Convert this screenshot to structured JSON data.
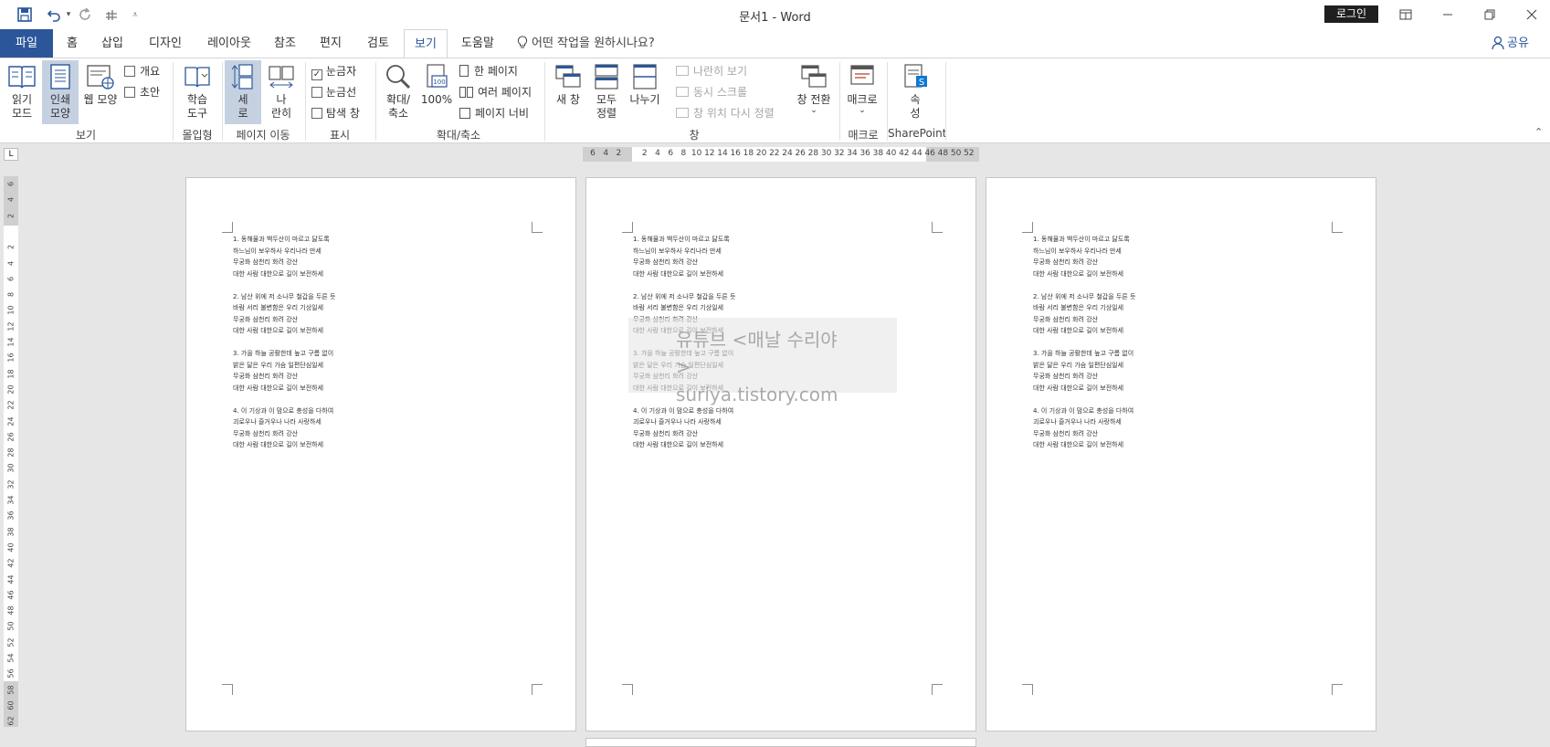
{
  "titlebar": {
    "title": "문서1  -  Word",
    "login_label": "로그인",
    "save_icon": "save-icon",
    "undo_icon": "undo-icon",
    "redo_icon": "redo-icon",
    "touch_icon": "touch-mode-icon",
    "customize_icon": "customize-icon"
  },
  "tabs": {
    "file": "파일",
    "home": "홈",
    "insert": "삽입",
    "design": "디자인",
    "layout": "레이아웃",
    "references": "참조",
    "mailings": "편지",
    "review": "검토",
    "view": "보기",
    "help": "도움말",
    "tell_me": "어떤 작업을 원하시나요?",
    "share": "공유"
  },
  "ribbon": {
    "views": {
      "read_mode": "읽기\n모드",
      "print_layout": "인쇄\n모양",
      "web_layout": "웹 모양",
      "outline": "개요",
      "draft": "초안",
      "group": "보기"
    },
    "immersive": {
      "learning_tools": "학습\n도구",
      "group": "몰입형"
    },
    "page_movement": {
      "vertical": "세\n로",
      "side_to_side": "나\n란히",
      "group": "페이지 이동"
    },
    "show": {
      "ruler": "눈금자",
      "gridlines": "눈금선",
      "navigation": "탐색 창",
      "ruler_checked": true,
      "gridlines_checked": false,
      "navigation_checked": false,
      "group": "표시"
    },
    "zoom": {
      "zoom": "확대/\n축소",
      "hundred": "100%",
      "one_page": "한 페이지",
      "multiple_pages": "여러 페이지",
      "page_width": "페이지 너비",
      "group": "확대/축소"
    },
    "window": {
      "new_window": "새 창",
      "arrange_all": "모두\n정렬",
      "split": "나누기",
      "side_by_side": "나란히 보기",
      "sync_scroll": "동시 스크롤",
      "reset_window": "창 위치 다시 정렬",
      "switch_windows": "창 전환",
      "group": "창"
    },
    "macros": {
      "macros": "매크로",
      "group": "매크로"
    },
    "sharepoint": {
      "properties": "속\n성",
      "group": "SharePoint"
    }
  },
  "ruler": {
    "h_ticks": [
      "6",
      "4",
      "2",
      "",
      "2",
      "4",
      "6",
      "8",
      "10",
      "12",
      "14",
      "16",
      "18",
      "20",
      "22",
      "24",
      "26",
      "28",
      "30",
      "32",
      "34",
      "36",
      "38",
      "40",
      "42",
      "44",
      "46",
      "48",
      "50",
      "52"
    ],
    "v_ticks": [
      "6",
      "4",
      "2",
      "",
      "2",
      "4",
      "6",
      "8",
      "10",
      "12",
      "14",
      "16",
      "18",
      "20",
      "22",
      "24",
      "26",
      "28",
      "30",
      "32",
      "34",
      "36",
      "38",
      "40",
      "42",
      "44",
      "46",
      "48",
      "50",
      "52",
      "54",
      "56",
      "58",
      "60",
      "62"
    ],
    "tab_selector": "L"
  },
  "document": {
    "lines": [
      "1. 동해물과 백두산이 마르고 닳도록",
      "하느님이 보우하사 우리나라 만세",
      "무궁화 삼천리 화려 강산",
      "대한 사람 대한으로 길이 보전하세",
      "",
      "2. 남산 위에 저 소나무 철갑을 두른 듯",
      "바람 서리 불변함은 우리 기상일세",
      "무궁화 삼천리 화려 강산",
      "대한 사람 대한으로 길이 보전하세",
      "",
      "3. 가을 하늘 공활한데 높고 구름 없이",
      "밝은 달은 우리 가슴 일편단심일세",
      "무궁화 삼천리 화려 강산",
      "대한 사람 대한으로 길이 보전하세",
      "",
      "4. 이 기상과 이 맘으로 충성을 다하여",
      "괴로우나 즐거우나 나라 사랑하세",
      "무궁화 삼천리 화려 강산",
      "대한 사람 대한으로 길이 보전하세"
    ]
  },
  "watermark": {
    "line1": "유튜브 <매날 수리야>",
    "line2": "suriya.tistory.com"
  },
  "colors": {
    "brand": "#2b579a",
    "selected": "#c5d1e1"
  }
}
